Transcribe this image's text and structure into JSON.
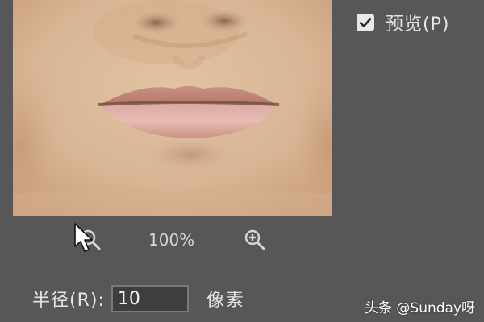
{
  "preview": {
    "checkbox_checked": true,
    "label": "预览(P)"
  },
  "zoom": {
    "level": "100%",
    "zoom_out_icon": "zoom-out-icon",
    "zoom_in_icon": "zoom-in-icon"
  },
  "radius": {
    "label": "半径(R):",
    "value": "10",
    "unit": "像素"
  },
  "watermark": {
    "text": "头条 @Sunday呀"
  },
  "colors": {
    "panel_bg": "#575757",
    "input_bg": "#3e3e3e",
    "text": "#e6e6e6"
  }
}
